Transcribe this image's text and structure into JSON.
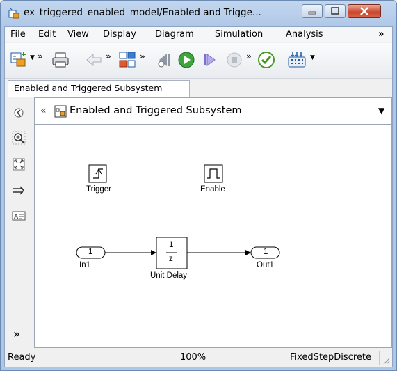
{
  "window": {
    "title": "ex_triggered_enabled_model/Enabled and Trigge...",
    "minimize_icon": "minimize-icon",
    "maximize_icon": "maximize-icon",
    "close_icon": "close-icon"
  },
  "menu": {
    "items": [
      "File",
      "Edit",
      "View",
      "Display",
      "Diagram",
      "Simulation",
      "Analysis"
    ],
    "overflow": "»"
  },
  "toolbar": {
    "icons": [
      "model-browser-icon",
      "print-icon",
      "back-icon",
      "library-browser-icon",
      "step-back-icon",
      "run-icon",
      "step-forward-icon",
      "stop-icon",
      "model-advisor-icon",
      "build-icon"
    ],
    "chevron": "»",
    "dropdown": "▼"
  },
  "tabs": [
    {
      "label": "Enabled and Triggered Subsystem"
    }
  ],
  "palette": {
    "icons": [
      "hide-browser-icon",
      "zoom-icon",
      "fit-view-icon",
      "signal-arrow-icon",
      "annotation-icon",
      "more-icon"
    ],
    "more": "»"
  },
  "breadcrumb": {
    "back": "«",
    "path": "Enabled and Triggered Subsystem",
    "dropdown": "▼"
  },
  "diagram": {
    "trigger_label": "Trigger",
    "enable_label": "Enable",
    "in_port_number": "1",
    "in_port_label": "In1",
    "out_port_number": "1",
    "out_port_label": "Out1",
    "delay_num": "1",
    "delay_den": "z",
    "delay_label": "Unit Delay"
  },
  "status": {
    "state": "Ready",
    "zoom": "100%",
    "solver": "FixedStepDiscrete"
  },
  "colors": {
    "title_bar": "#b9cfea",
    "close_button": "#c9462c",
    "run_green": "#3ea53e",
    "step_purple": "#7b6fd0"
  }
}
